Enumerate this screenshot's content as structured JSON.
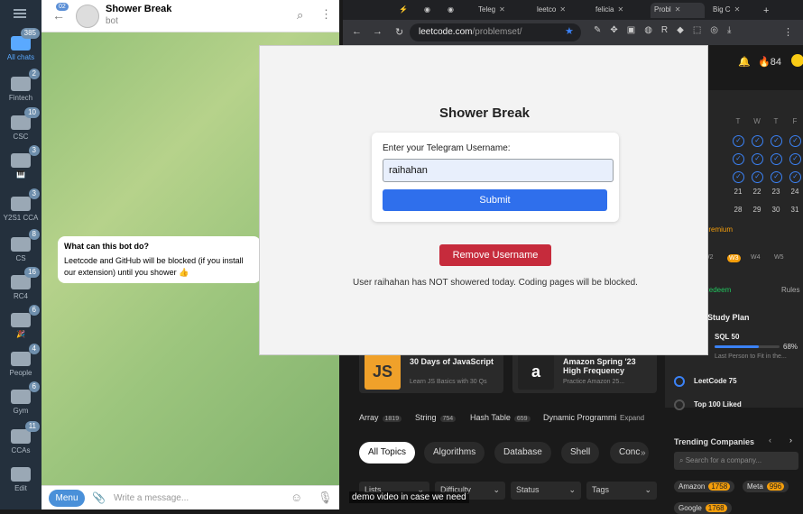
{
  "telegram": {
    "nav": [
      {
        "label": "All chats",
        "badge": "385"
      },
      {
        "label": "Fintech",
        "badge": "2"
      },
      {
        "label": "CSC",
        "badge": "10"
      },
      {
        "label": "🎹",
        "badge": "3"
      },
      {
        "label": "Y2S1 CCA",
        "badge": "3"
      },
      {
        "label": "CS",
        "badge": "8"
      },
      {
        "label": "RC4",
        "badge": "16"
      },
      {
        "label": "🎉",
        "badge": "6"
      },
      {
        "label": "People",
        "badge": "4"
      },
      {
        "label": "Gym",
        "badge": "6"
      },
      {
        "label": "CCAs",
        "badge": "11"
      },
      {
        "label": "Edit",
        "badge": ""
      }
    ],
    "back_badge": "02",
    "chat_title": "Shower Break",
    "chat_subtitle": "bot",
    "bubble_title": "What can this bot do?",
    "bubble_text": "Leetcode and GitHub will be blocked (if you install our extension) until you shower 👍",
    "menu_label": "Menu",
    "input_placeholder": "Write a message..."
  },
  "browser": {
    "tabs": [
      "Teleg",
      "leetco",
      "felicia",
      "Probl",
      "Big C"
    ],
    "url_host": "leetcode.com",
    "url_path": "/problemset/",
    "streak": "84"
  },
  "modal": {
    "title": "Shower Break",
    "label": "Enter your Telegram Username:",
    "username_value": "raihahan",
    "submit_label": "Submit",
    "remove_label": "Remove Username",
    "status": "User raihahan has NOT showered today. Coding pages will be blocked."
  },
  "leetcode": {
    "cards": [
      {
        "title": "30 Days of JavaScript",
        "sub": "Learn JS Basics with 30 Qs",
        "icon": "JS"
      },
      {
        "title": "Amazon Spring '23 High Frequency",
        "sub": "Practice Amazon 25...",
        "icon": "a"
      }
    ],
    "tags": [
      {
        "name": "Array",
        "count": "1819"
      },
      {
        "name": "String",
        "count": "754"
      },
      {
        "name": "Hash Table",
        "count": "659"
      },
      {
        "name": "Dynamic Programmi",
        "count": ""
      }
    ],
    "expand": "Expand",
    "topics": [
      "All Topics",
      "Algorithms",
      "Database",
      "Shell",
      "Conc"
    ],
    "filters": [
      "Lists",
      "Difficulty",
      "Status",
      "Tags"
    ],
    "calendar": {
      "days": [
        "T",
        "W",
        "T",
        "F",
        "S"
      ],
      "row1": [
        "21",
        "22",
        "23",
        "24",
        "25"
      ],
      "row2": [
        "28",
        "29",
        "30",
        "31"
      ]
    },
    "premium": "Premium",
    "weeks": [
      "W2",
      "W3",
      "W4",
      "W5"
    ],
    "redeem": "Redeem",
    "rules": "Rules",
    "study_plan": "Study Plan",
    "sql_title": "SQL 50",
    "sql_pct": "68%",
    "sql_progress": 0.68,
    "sql_sub": "Last Person to Fit in the...",
    "plans": [
      "LeetCode 75",
      "Top 100 Liked"
    ],
    "trending": "Trending Companies",
    "search_company": "Search for a company...",
    "companies": [
      {
        "name": "Amazon",
        "count": "1758"
      },
      {
        "name": "Meta",
        "count": "996"
      },
      {
        "name": "Google",
        "count": "1768"
      }
    ]
  },
  "caption": "demo video in case we need"
}
